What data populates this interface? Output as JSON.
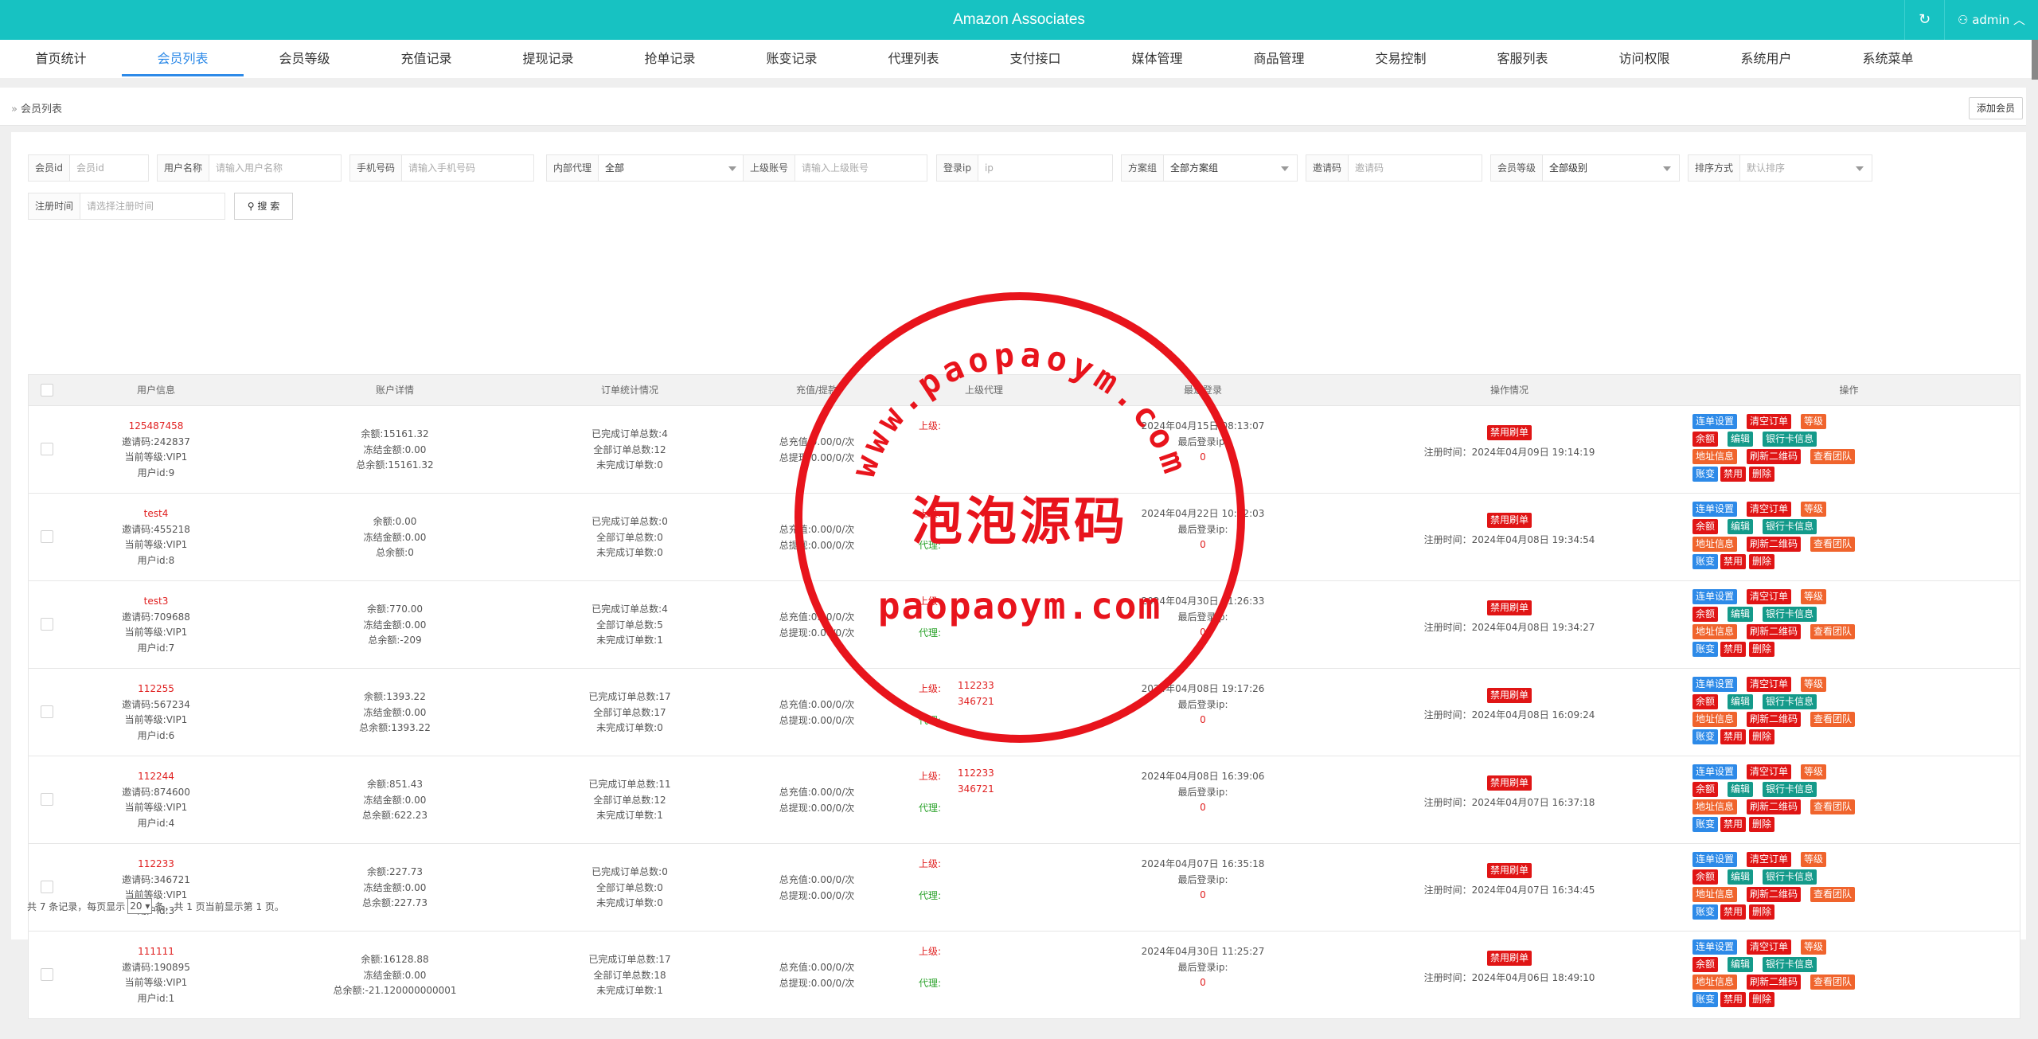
{
  "app": {
    "title": "Amazon Associates",
    "refresh_icon": "refresh-icon",
    "user_icon": "user-icon",
    "user_label": "admin"
  },
  "nav": {
    "items": [
      "首页统计",
      "会员列表",
      "会员等级",
      "充值记录",
      "提现记录",
      "抢单记录",
      "账变记录",
      "代理列表",
      "支付接口",
      "媒体管理",
      "商品管理",
      "交易控制",
      "客服列表",
      "访问权限",
      "系统用户",
      "系统菜单"
    ],
    "active_index": 1
  },
  "breadcrumb": {
    "current": "会员列表"
  },
  "add_member_label": "添加会员",
  "filters": {
    "member_id": {
      "label": "会员id",
      "placeholder": "会员id"
    },
    "username": {
      "label": "用户名称",
      "placeholder": "请输入用户名称"
    },
    "phone": {
      "label": "手机号码",
      "placeholder": "请输入手机号码"
    },
    "agent": {
      "label": "内部代理",
      "value": "全部"
    },
    "parent": {
      "label": "上级账号",
      "placeholder": "请输入上级账号"
    },
    "login_ip": {
      "label": "登录ip",
      "placeholder": "ip"
    },
    "plan": {
      "label": "方案组",
      "value": "全部方案组"
    },
    "invite": {
      "label": "邀请码",
      "placeholder": "邀请码"
    },
    "level": {
      "label": "会员等级",
      "value": "全部级别"
    },
    "sort": {
      "label": "排序方式",
      "value": "默认排序"
    },
    "reg_time": {
      "label": "注册时间",
      "placeholder": "请选择注册时间"
    },
    "search_label": "搜 索"
  },
  "table": {
    "headers": [
      "用户信息",
      "账户详情",
      "订单统计情况",
      "充值/提款",
      "上级代理",
      "最近登录",
      "操作情况",
      "操作"
    ],
    "buttons": {
      "r1": [
        "连单设置",
        "清空订单",
        "等级"
      ],
      "r2": [
        "余额",
        "编辑",
        "银行卡信息"
      ],
      "r3": [
        "地址信息",
        "刷新二维码",
        "查看团队"
      ],
      "r4": [
        "账变",
        "禁用",
        "删除"
      ]
    },
    "disable_label": "禁用刷单",
    "reg_prefix": "注册时间：",
    "parent_label": "上级:",
    "agent_label": "代理:",
    "last_ip_label": "最后登录ip:",
    "rows": [
      {
        "name": "125487458",
        "invite": "邀请码:242837",
        "level": "当前等级:VIP1",
        "uid": "用户id:9",
        "bal": "余额:15161.32",
        "frozen": "冻结金额:0.00",
        "total": "总余额:15161.32",
        "done": "已完成订单总数:4",
        "all": "全部订单总数:12",
        "undone": "未完成订单数:0",
        "rech": "总充值:0.00/0/次",
        "wd": "总提现:0.00/0/次",
        "parents": [],
        "login": "2024年04月15日 08:13:07",
        "ip": "0",
        "reg": "2024年04月09日 19:14:19",
        "show_agent": false
      },
      {
        "name": "test4",
        "invite": "邀请码:455218",
        "level": "当前等级:VIP1",
        "uid": "用户id:8",
        "bal": "余额:0.00",
        "frozen": "冻结金额:0.00",
        "total": "总余额:0",
        "done": "已完成订单总数:0",
        "all": "全部订单总数:0",
        "undone": "未完成订单数:0",
        "rech": "总充值:0.00/0/次",
        "wd": "总提现:0.00/0/次",
        "parents": [],
        "login": "2024年04月22日 10:52:03",
        "ip": "0",
        "reg": "2024年04月08日 19:34:54",
        "show_agent": true
      },
      {
        "name": "test3",
        "invite": "邀请码:709688",
        "level": "当前等级:VIP1",
        "uid": "用户id:7",
        "bal": "余额:770.00",
        "frozen": "冻结金额:0.00",
        "total": "总余额:-209",
        "done": "已完成订单总数:4",
        "all": "全部订单总数:5",
        "undone": "未完成订单数:1",
        "rech": "总充值:0.00/0/次",
        "wd": "总提现:0.00/0/次",
        "parents": [],
        "login": "2024年04月30日 11:26:33",
        "ip": "0",
        "reg": "2024年04月08日 19:34:27",
        "show_agent": true
      },
      {
        "name": "112255",
        "invite": "邀请码:567234",
        "level": "当前等级:VIP1",
        "uid": "用户id:6",
        "bal": "余额:1393.22",
        "frozen": "冻结金额:0.00",
        "total": "总余额:1393.22",
        "done": "已完成订单总数:17",
        "all": "全部订单总数:17",
        "undone": "未完成订单数:0",
        "rech": "总充值:0.00/0/次",
        "wd": "总提现:0.00/0/次",
        "parents": [
          "112233",
          "346721"
        ],
        "login": "2024年04月08日 19:17:26",
        "ip": "0",
        "reg": "2024年04月08日 16:09:24",
        "show_agent": true
      },
      {
        "name": "112244",
        "invite": "邀请码:874600",
        "level": "当前等级:VIP1",
        "uid": "用户id:4",
        "bal": "余额:851.43",
        "frozen": "冻结金额:0.00",
        "total": "总余额:622.23",
        "done": "已完成订单总数:11",
        "all": "全部订单总数:12",
        "undone": "未完成订单数:1",
        "rech": "总充值:0.00/0/次",
        "wd": "总提现:0.00/0/次",
        "parents": [
          "112233",
          "346721"
        ],
        "login": "2024年04月08日 16:39:06",
        "ip": "0",
        "reg": "2024年04月07日 16:37:18",
        "show_agent": true
      },
      {
        "name": "112233",
        "invite": "邀请码:346721",
        "level": "当前等级:VIP1",
        "uid": "用户id:3",
        "bal": "余额:227.73",
        "frozen": "冻结金额:0.00",
        "total": "总余额:227.73",
        "done": "已完成订单总数:0",
        "all": "全部订单总数:0",
        "undone": "未完成订单数:0",
        "rech": "总充值:0.00/0/次",
        "wd": "总提现:0.00/0/次",
        "parents": [],
        "login": "2024年04月07日 16:35:18",
        "ip": "0",
        "reg": "2024年04月07日 16:34:45",
        "show_agent": true
      },
      {
        "name": "111111",
        "invite": "邀请码:190895",
        "level": "当前等级:VIP1",
        "uid": "用户id:1",
        "bal": "余额:16128.88",
        "frozen": "冻结金额:0.00",
        "total": "总余额:-21.120000000001",
        "done": "已完成订单总数:17",
        "all": "全部订单总数:18",
        "undone": "未完成订单数:1",
        "rech": "总充值:0.00/0/次",
        "wd": "总提现:0.00/0/次",
        "parents": [],
        "login": "2024年04月30日 11:25:27",
        "ip": "0",
        "reg": "2024年04月06日 18:49:10",
        "show_agent": true
      }
    ]
  },
  "footer": {
    "pre": "共 7 条记录，每页显示",
    "page_size": "20",
    "post": "条，共 1 页当前显示第 1 页。"
  },
  "watermark": {
    "top_text": "www.paopaoym.com",
    "center_text": "泡泡源码",
    "bottom_text": "paopaoym.com",
    "color": "#e8141c"
  }
}
